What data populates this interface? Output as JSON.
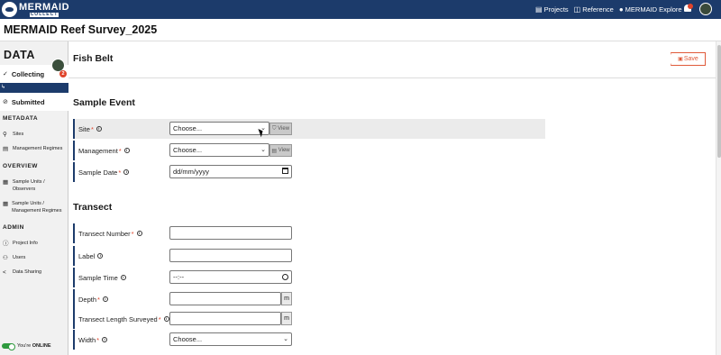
{
  "topbar": {
    "logo_main": "MERMAID",
    "logo_sub": "COLLECT",
    "links": [
      {
        "icon": "folder-icon",
        "glyph": "▤",
        "label": "Projects"
      },
      {
        "icon": "book-icon",
        "glyph": "◫",
        "label": "Reference"
      },
      {
        "icon": "globe-icon",
        "glyph": "●",
        "label": "MERMAID Explore"
      }
    ]
  },
  "project": {
    "title": "MERMAID Reef Survey_2025"
  },
  "sidebar": {
    "section_title": "DATA",
    "badge_count": "2",
    "collecting_label": "Collecting",
    "submitted_label": "Submitted",
    "metadata_head": "METADATA",
    "metadata_items": [
      "Sites",
      "Management Regimes"
    ],
    "overview_head": "OVERVIEW",
    "overview_items": [
      "Sample Units / Observers",
      "Sample Units / Management Regimes"
    ],
    "admin_head": "ADMIN",
    "admin_items": [
      "Project Info",
      "Users",
      "Data Sharing"
    ],
    "online_prefix": "You're",
    "online_status": "ONLINE"
  },
  "page": {
    "title": "Fish Belt",
    "save_label": "Save"
  },
  "sample_event": {
    "title": "Sample Event",
    "site": {
      "label": "Site",
      "value": "Choose...",
      "view": "View"
    },
    "management": {
      "label": "Management",
      "value": "Choose...",
      "view": "View"
    },
    "sample_date": {
      "label": "Sample Date",
      "value": "dd/mm/yyyy"
    }
  },
  "transect": {
    "title": "Transect",
    "transect_number": {
      "label": "Transect Number"
    },
    "label": {
      "label": "Label"
    },
    "sample_time": {
      "label": "Sample Time",
      "value": "--:--"
    },
    "depth": {
      "label": "Depth",
      "unit": "m"
    },
    "transect_length": {
      "label": "Transect Length Surveyed",
      "unit": "m"
    },
    "width": {
      "label": "Width",
      "value": "Choose..."
    }
  },
  "colors": {
    "navy": "#1c3b6b",
    "accent": "#e0442b",
    "online": "#2e9a3e"
  }
}
